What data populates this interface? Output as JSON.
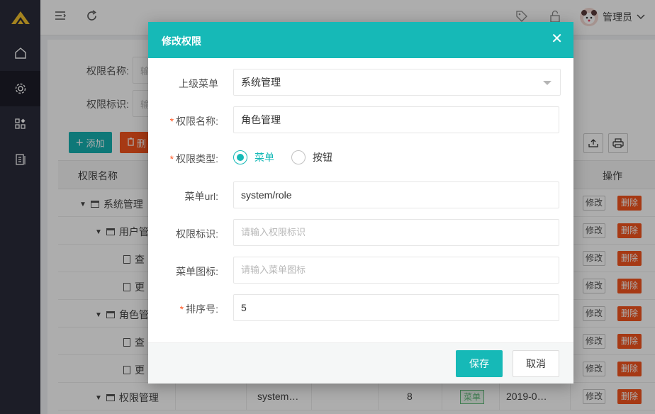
{
  "topbar": {
    "username": "管理员"
  },
  "search": {
    "name_label": "权限名称:",
    "name_placeholder": "输",
    "key_label": "权限标识:",
    "key_placeholder": "输"
  },
  "toolbar": {
    "add_label": "添加",
    "delete_label": "删"
  },
  "table": {
    "headers": {
      "name": "权限名称",
      "ops": "操作"
    },
    "edit_label": "修改",
    "delete_label": "删除",
    "rows": [
      {
        "name": "系统管理"
      },
      {
        "name": "用户管"
      },
      {
        "name": "查"
      },
      {
        "name": "更"
      },
      {
        "name": "角色管"
      },
      {
        "name": "查"
      },
      {
        "name": "更"
      },
      {
        "name": "权限管理",
        "url": "system…",
        "sort": "8",
        "type": "菜单",
        "date": "2019-0…"
      }
    ]
  },
  "dialog": {
    "title": "修改权限",
    "close_symbol": "✕",
    "fields": {
      "parent": {
        "label": "上级菜单",
        "value": "系统管理"
      },
      "name": {
        "label": "权限名称:",
        "value": "角色管理"
      },
      "type": {
        "label": "权限类型:",
        "options": [
          "菜单",
          "按钮"
        ],
        "selected": "菜单"
      },
      "url": {
        "label": "菜单url:",
        "value": "system/role"
      },
      "key": {
        "label": "权限标识:",
        "placeholder": "请输入权限标识"
      },
      "icon": {
        "label": "菜单图标:",
        "placeholder": "请输入菜单图标"
      },
      "sort": {
        "label": "排序号:",
        "value": "5"
      }
    },
    "required_mark": "*",
    "save_label": "保存",
    "cancel_label": "取消"
  },
  "colors": {
    "primary": "#16b9b7",
    "danger": "#f5551e",
    "sidebar": "#2a2c3a"
  }
}
